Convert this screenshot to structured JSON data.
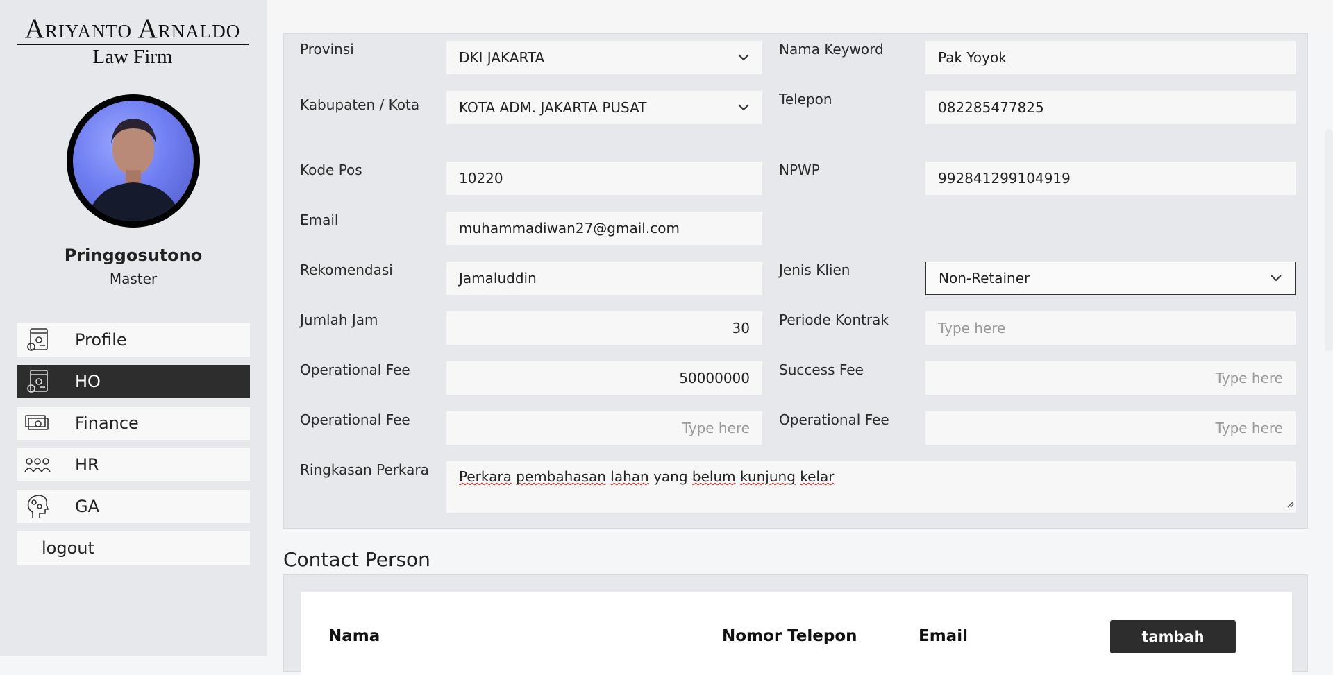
{
  "brand": {
    "line1": "Ariyanto Arnaldo",
    "line2": "Law Firm"
  },
  "user": {
    "name": "Pringgosutono",
    "role": "Master"
  },
  "nav": [
    {
      "label": "Profile",
      "icon": "profile-settings-icon"
    },
    {
      "label": "HO",
      "icon": "ho-settings-icon"
    },
    {
      "label": "Finance",
      "icon": "money-icon"
    },
    {
      "label": "HR",
      "icon": "people-icon"
    },
    {
      "label": "GA",
      "icon": "head-gears-icon"
    },
    {
      "label": "logout",
      "icon": ""
    }
  ],
  "form": {
    "provinsi": {
      "label": "Provinsi",
      "value": "DKI JAKARTA"
    },
    "kabupaten": {
      "label": "Kabupaten / Kota",
      "value": "KOTA ADM. JAKARTA PUSAT"
    },
    "kode_pos": {
      "label": "Kode Pos",
      "value": "10220"
    },
    "email": {
      "label": "Email",
      "value": "muhammadiwan27@gmail.com"
    },
    "rekomendasi": {
      "label": "Rekomendasi",
      "value": "Jamaluddin"
    },
    "jumlah_jam": {
      "label": "Jumlah Jam",
      "value": "30"
    },
    "operational_fee_1": {
      "label": "Operational Fee",
      "value": "50000000"
    },
    "operational_fee_2": {
      "label": "Operational Fee",
      "placeholder": "Type here"
    },
    "ringkasan": {
      "label": "Ringkasan Perkara",
      "words": [
        "Perkara",
        "pembahasan",
        "lahan",
        "yang",
        "belum",
        "kunjung",
        "kelar"
      ]
    },
    "nama_keyword": {
      "label": "Nama Keyword",
      "value": "Pak Yoyok"
    },
    "telepon": {
      "label": "Telepon",
      "value": "082285477825"
    },
    "npwp": {
      "label": "NPWP",
      "value": "992841299104919"
    },
    "jenis_klien": {
      "label": "Jenis Klien",
      "value": "Non-Retainer"
    },
    "periode_kontrak": {
      "label": "Periode Kontrak",
      "placeholder": "Type here"
    },
    "success_fee": {
      "label": "Success Fee",
      "placeholder": "Type here"
    },
    "operational_fee_3": {
      "label": "Operational Fee",
      "placeholder": "Type here"
    }
  },
  "contact": {
    "title": "Contact Person",
    "columns": [
      "Nama",
      "Nomor Telepon",
      "Email"
    ],
    "add_label": "tambah"
  }
}
